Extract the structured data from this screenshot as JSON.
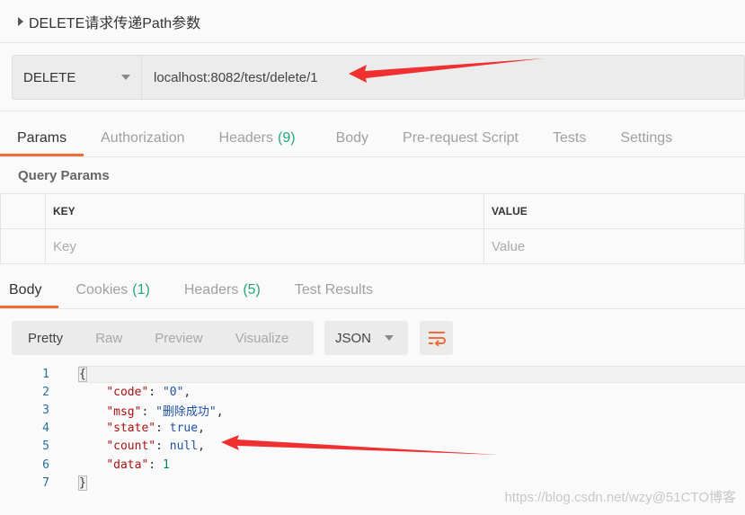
{
  "request": {
    "title": "DELETE请求传递Path参数",
    "method": "DELETE",
    "url": "localhost:8082/test/delete/1"
  },
  "request_tabs": [
    {
      "label": "Params"
    },
    {
      "label": "Authorization"
    },
    {
      "label": "Headers",
      "count": "(9)"
    },
    {
      "label": "Body"
    },
    {
      "label": "Pre-request Script"
    },
    {
      "label": "Tests"
    },
    {
      "label": "Settings"
    }
  ],
  "query_params": {
    "title": "Query Params",
    "key_header": "KEY",
    "value_header": "VALUE",
    "key_placeholder": "Key",
    "value_placeholder": "Value"
  },
  "response_tabs": [
    {
      "label": "Body"
    },
    {
      "label": "Cookies",
      "count": "(1)"
    },
    {
      "label": "Headers",
      "count": "(5)"
    },
    {
      "label": "Test Results"
    }
  ],
  "view_modes": [
    "Pretty",
    "Raw",
    "Preview",
    "Visualize"
  ],
  "format": "JSON",
  "accent": "#f26b3a",
  "watermark": "https://blog.csdn.net/wzy@51CTO博客",
  "code": {
    "lines": [
      "1",
      "2",
      "3",
      "4",
      "5",
      "6",
      "7"
    ],
    "code_key": "\"code\"",
    "code_val": "\"0\"",
    "msg_key": "\"msg\"",
    "msg_val": "\"删除成功\"",
    "state_key": "\"state\"",
    "state_val": "true",
    "count_key": "\"count\"",
    "count_val": "null",
    "data_key": "\"data\"",
    "data_val": "1"
  }
}
